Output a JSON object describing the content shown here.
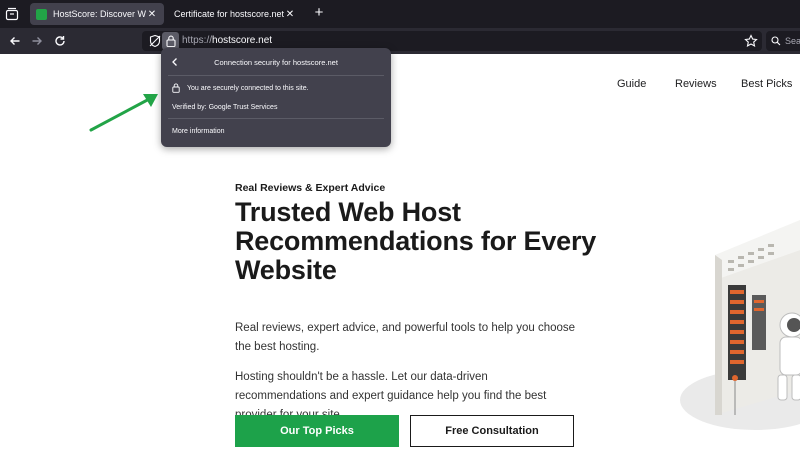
{
  "browser": {
    "tabs": [
      {
        "title": "HostScore: Discover Web Hosts",
        "active": true
      },
      {
        "title": "Certificate for hostscore.net",
        "active": false
      }
    ],
    "url": {
      "scheme": "https://",
      "host": "hostscore.net"
    },
    "search_placeholder": "Sea",
    "icons": [
      "tab-overview-icon",
      "back-icon",
      "forward-icon",
      "reload-icon",
      "tracking-shield-icon",
      "lock-icon",
      "bookmark-star-icon",
      "search-icon",
      "new-tab-icon",
      "close-icon"
    ]
  },
  "popup": {
    "title": "Connection security for hostscore.net",
    "secure_text": "You are securely connected to this site.",
    "verified_by": "Verified by: Google Trust Services",
    "more_info": "More information"
  },
  "site": {
    "nav": [
      "Guide",
      "Reviews",
      "Best Picks"
    ],
    "eyebrow": "Real Reviews & Expert Advice",
    "headline": "Trusted Web Host Recommendations for Every Website",
    "paragraph1": "Real reviews, expert advice, and powerful tools to help you choose the best hosting.",
    "paragraph2": "Hosting shouldn't be a hassle. Let our data-driven recommendations and expert guidance help you find the best provider for your site.",
    "primary_button": "Our Top Picks",
    "secondary_button": "Free Consultation"
  },
  "colors": {
    "accent_green": "#1da24a",
    "annotation_arrow": "#22a447",
    "chrome_dark": "#1c1b22",
    "toolbar": "#2b2a33",
    "popup_bg": "#42414d"
  }
}
